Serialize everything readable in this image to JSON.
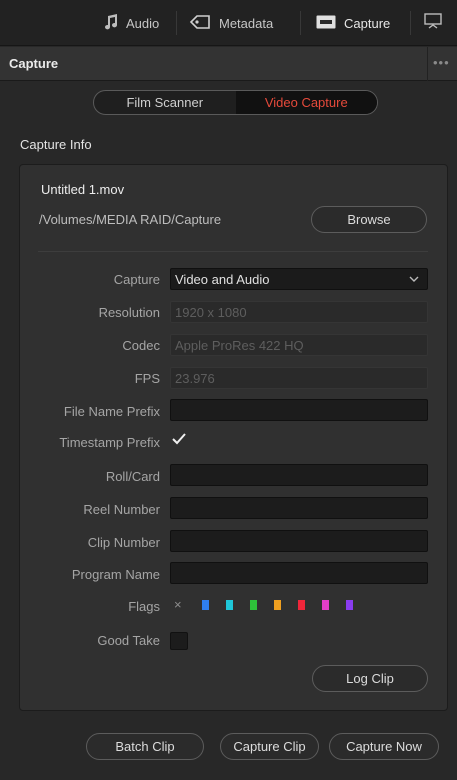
{
  "top_tabs": {
    "audio": "Audio",
    "metadata": "Metadata",
    "capture": "Capture"
  },
  "panel": {
    "title": "Capture",
    "menu_dots": "•••"
  },
  "mode_switch": {
    "options": [
      "Film Scanner",
      "Video Capture"
    ],
    "active": "Video Capture"
  },
  "capture_info": {
    "section_label": "Capture Info",
    "file_name": "Untitled 1.mov",
    "path": "/Volumes/MEDIA RAID/Capture",
    "browse_label": "Browse"
  },
  "form": {
    "capture": {
      "label": "Capture",
      "value": "Video and Audio"
    },
    "resolution": {
      "label": "Resolution",
      "value": "1920 x 1080"
    },
    "codec": {
      "label": "Codec",
      "value": "Apple ProRes 422 HQ"
    },
    "fps": {
      "label": "FPS",
      "value": "23.976"
    },
    "file_name_prefix": {
      "label": "File Name Prefix",
      "value": ""
    },
    "timestamp_prefix": {
      "label": "Timestamp Prefix",
      "checked": true
    },
    "roll_card": {
      "label": "Roll/Card",
      "value": ""
    },
    "reel_number": {
      "label": "Reel Number",
      "value": ""
    },
    "clip_number": {
      "label": "Clip Number",
      "value": ""
    },
    "program_name": {
      "label": "Program Name",
      "value": ""
    },
    "flags": {
      "label": "Flags",
      "clear_symbol": "×",
      "colors": [
        "#2f7ff0",
        "#1fc6d8",
        "#2ec03a",
        "#f0a020",
        "#f0263a",
        "#e33ec8",
        "#8a3cf0"
      ]
    },
    "good_take": {
      "label": "Good Take",
      "checked": false
    }
  },
  "log_clip_label": "Log Clip",
  "footer": {
    "batch_clip": "Batch Clip",
    "capture_clip": "Capture Clip",
    "capture_now": "Capture Now"
  },
  "colors": {
    "accent": "#e64a3b"
  }
}
